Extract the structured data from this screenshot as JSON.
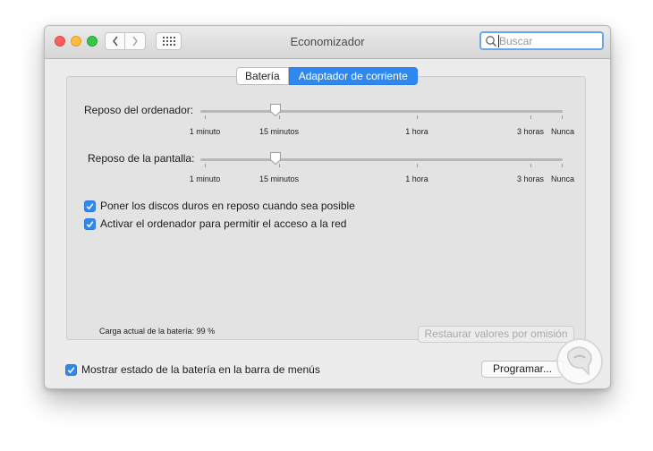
{
  "window": {
    "title": "Economizador"
  },
  "search": {
    "placeholder": "Buscar"
  },
  "tabs": [
    {
      "label": "Batería",
      "active": false
    },
    {
      "label": "Adaptador de corriente",
      "active": true
    }
  ],
  "sliders": [
    {
      "label": "Reposo del ordenador:",
      "value": "15 minutos",
      "ticks": [
        "1 minuto",
        "15 minutos",
        "1 hora",
        "3 horas",
        "Nunca"
      ]
    },
    {
      "label": "Reposo de la pantalla:",
      "value": "15 minutos",
      "ticks": [
        "1 minuto",
        "15 minutos",
        "1 hora",
        "3 horas",
        "Nunca"
      ]
    }
  ],
  "checkboxes": [
    {
      "label": "Poner los discos duros en reposo cuando sea posible",
      "checked": true
    },
    {
      "label": "Activar el ordenador para permitir el acceso a la red",
      "checked": true
    }
  ],
  "battery_charge": "Carga actual de la batería: 99 %",
  "restore_button": "Restaurar valores por omisión",
  "show_status": {
    "label": "Mostrar estado de la batería en la barra de menús",
    "checked": true
  },
  "schedule_button": "Programar...",
  "colors": {
    "accent": "#2f88ef",
    "window_bg": "#ececec"
  }
}
